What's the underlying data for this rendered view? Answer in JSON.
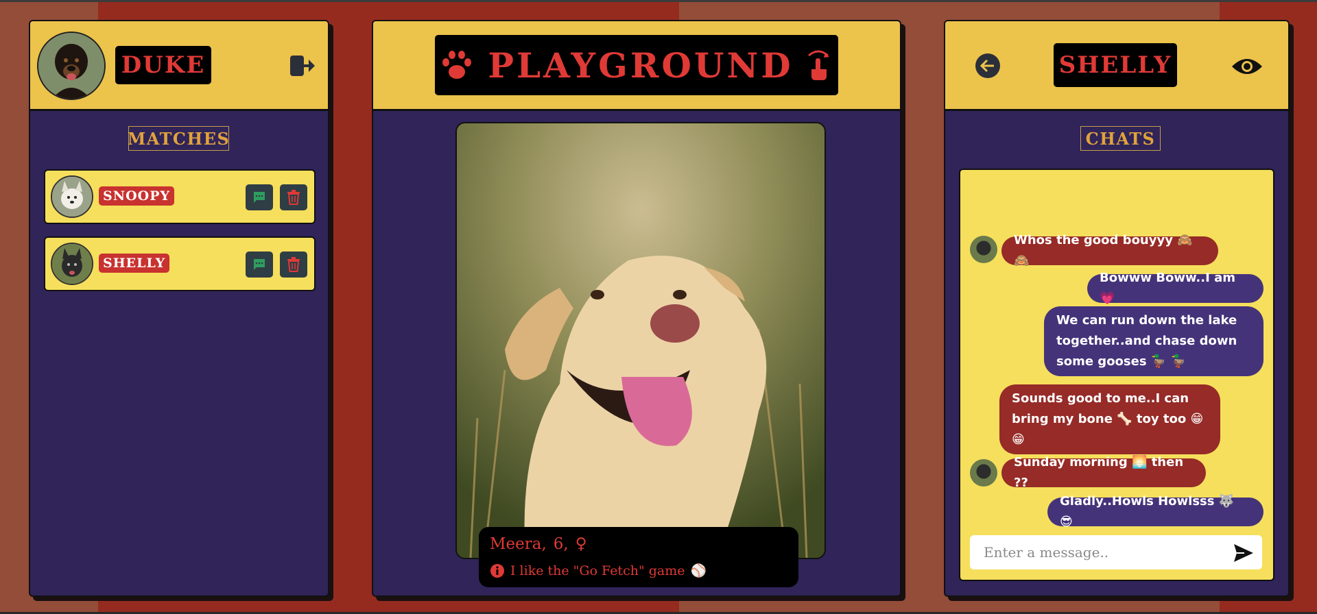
{
  "user": {
    "name": "DUKE"
  },
  "matches": {
    "title": "MATCHES",
    "items": [
      {
        "name": "SNOOPY"
      },
      {
        "name": "SHELLY"
      }
    ]
  },
  "brand": {
    "title": "PLAYGROUND"
  },
  "profile": {
    "name": "Meera,",
    "age": "6,",
    "gender_symbol": "♀",
    "bio": "I like the \"Go Fetch\" game",
    "bio_emoji": "⚾"
  },
  "chat": {
    "partner_name": "SHELLY",
    "title": "CHATS",
    "input_placeholder": "Enter a message..",
    "messages": [
      {
        "from": "them",
        "lines": [
          "Whos the good bouyyy 🙈 🙈"
        ]
      },
      {
        "from": "me",
        "lines": [
          "Bowww Boww..I am 💗"
        ]
      },
      {
        "from": "me",
        "lines": [
          "We can run down the lake",
          "together..and chase down",
          "some gooses 🦆 🦆"
        ]
      },
      {
        "from": "them",
        "lines": [
          "Sounds good to me..I can",
          "bring my bone 🦴 toy too 😁",
          "😁"
        ]
      },
      {
        "from": "them",
        "lines": [
          "Sunday morning 🌅 then ??"
        ]
      },
      {
        "from": "me",
        "lines": [
          "Gladly..Howls Howlsss 🐺 😎"
        ]
      }
    ]
  },
  "colors": {
    "panel_bg": "#302459",
    "header_bg": "#ecc34b",
    "card_bg": "#f6df5c",
    "accent_red": "#e03a36",
    "bubble_them": "#962b27",
    "bubble_me": "#45337a"
  }
}
